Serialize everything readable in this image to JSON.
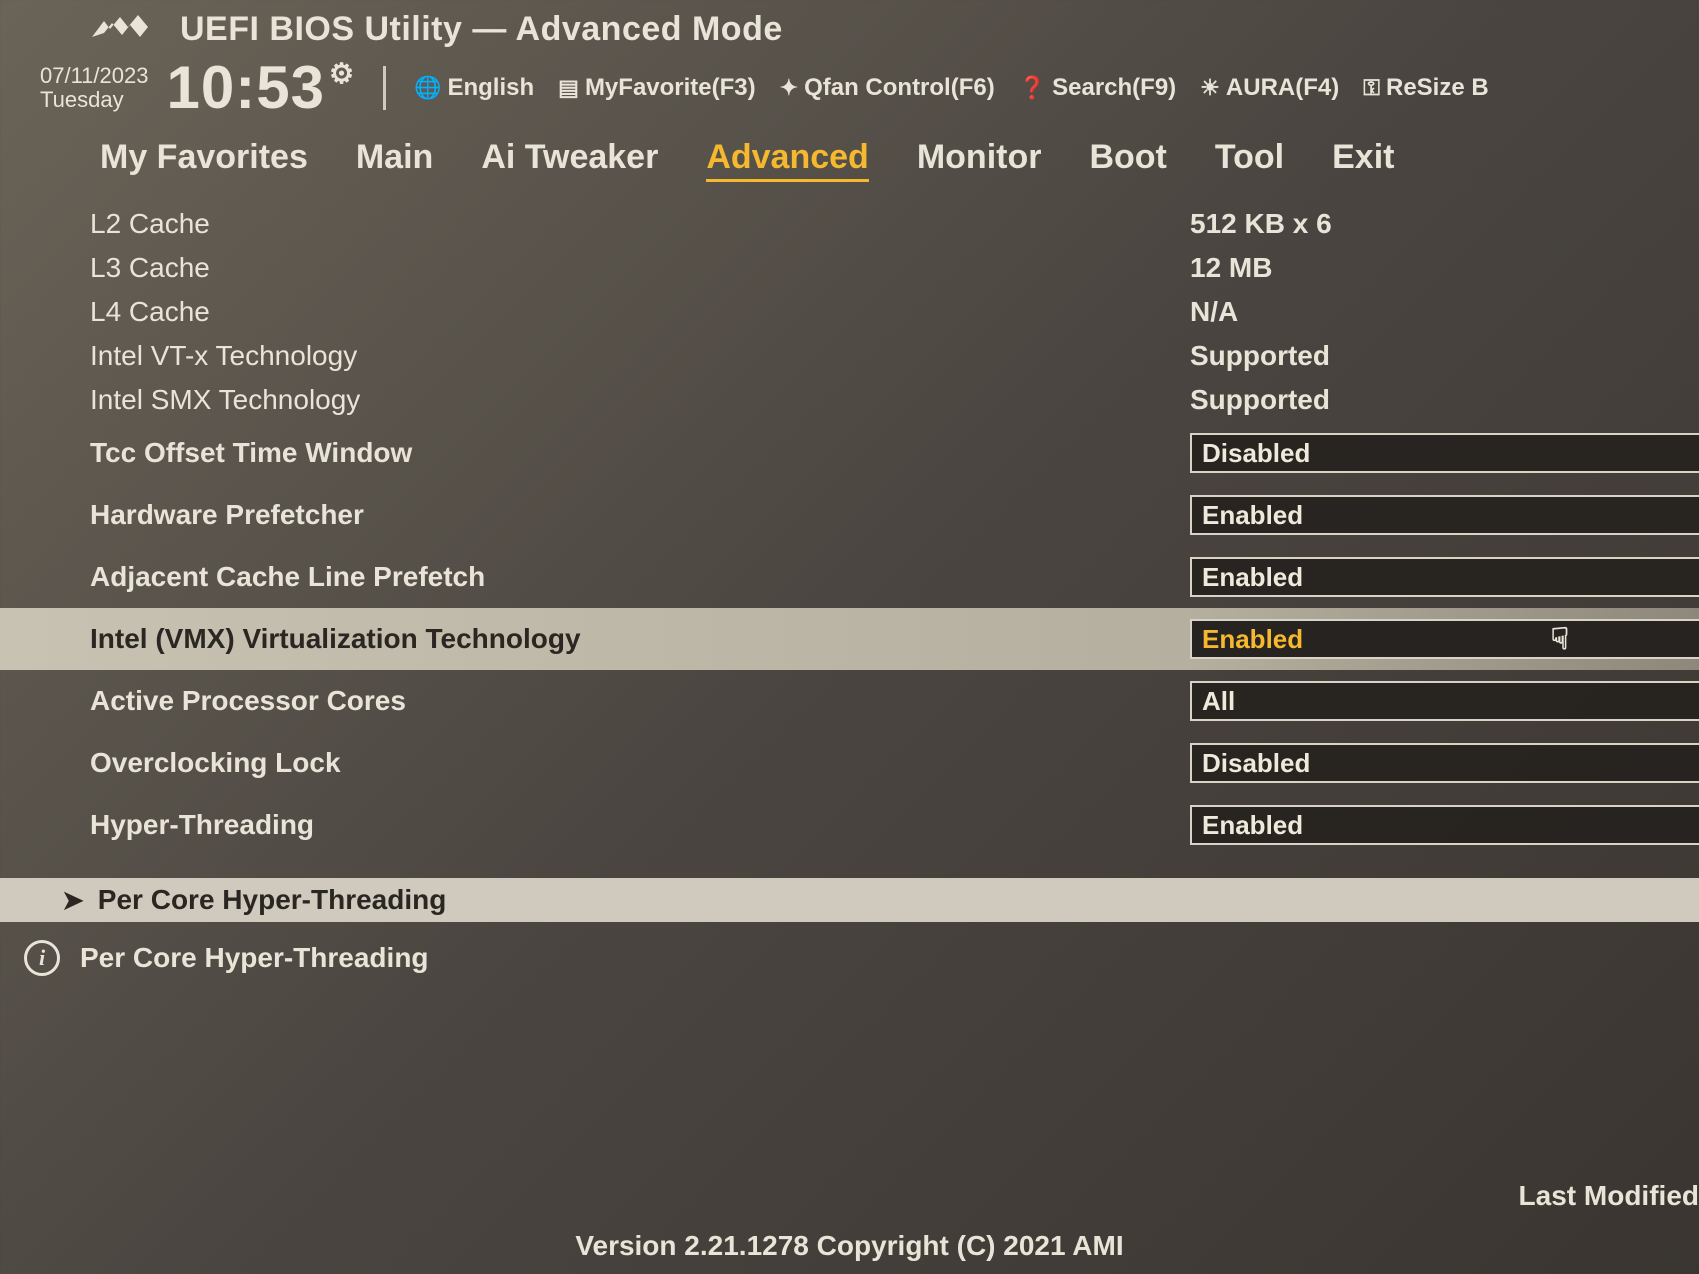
{
  "header": {
    "title": "UEFI BIOS Utility — Advanced Mode",
    "date": "07/11/2023",
    "day": "Tuesday",
    "time": "10:53"
  },
  "toolbar": {
    "language": "English",
    "myfavorite": "MyFavorite(F3)",
    "qfan": "Qfan Control(F6)",
    "search": "Search(F9)",
    "aura": "AURA(F4)",
    "resize": "ReSize B"
  },
  "tabs": [
    {
      "label": "My Favorites",
      "active": false
    },
    {
      "label": "Main",
      "active": false
    },
    {
      "label": "Ai Tweaker",
      "active": false
    },
    {
      "label": "Advanced",
      "active": true
    },
    {
      "label": "Monitor",
      "active": false
    },
    {
      "label": "Boot",
      "active": false
    },
    {
      "label": "Tool",
      "active": false
    },
    {
      "label": "Exit",
      "active": false
    }
  ],
  "info_rows": [
    {
      "label": "L2 Cache",
      "value": "512 KB x 6"
    },
    {
      "label": "L3 Cache",
      "value": "12 MB"
    },
    {
      "label": "L4 Cache",
      "value": "N/A"
    },
    {
      "label": "Intel VT-x Technology",
      "value": "Supported"
    },
    {
      "label": "Intel SMX Technology",
      "value": "Supported"
    }
  ],
  "option_rows": [
    {
      "label": "Tcc Offset Time Window",
      "value": "Disabled",
      "selected": false
    },
    {
      "label": "Hardware Prefetcher",
      "value": "Enabled",
      "selected": false
    },
    {
      "label": "Adjacent Cache Line Prefetch",
      "value": "Enabled",
      "selected": false
    },
    {
      "label": "Intel (VMX) Virtualization Technology",
      "value": "Enabled",
      "selected": true
    },
    {
      "label": "Active Processor Cores",
      "value": "All",
      "selected": false
    },
    {
      "label": "Overclocking Lock",
      "value": "Disabled",
      "selected": false
    },
    {
      "label": "Hyper-Threading",
      "value": "Enabled",
      "selected": false
    }
  ],
  "submenu": {
    "label": "Per Core Hyper-Threading"
  },
  "help": {
    "text": "Per Core Hyper-Threading"
  },
  "footer": {
    "last_modified": "Last Modified",
    "version": "Version 2.21.1278 Copyright (C) 2021 AMI"
  }
}
